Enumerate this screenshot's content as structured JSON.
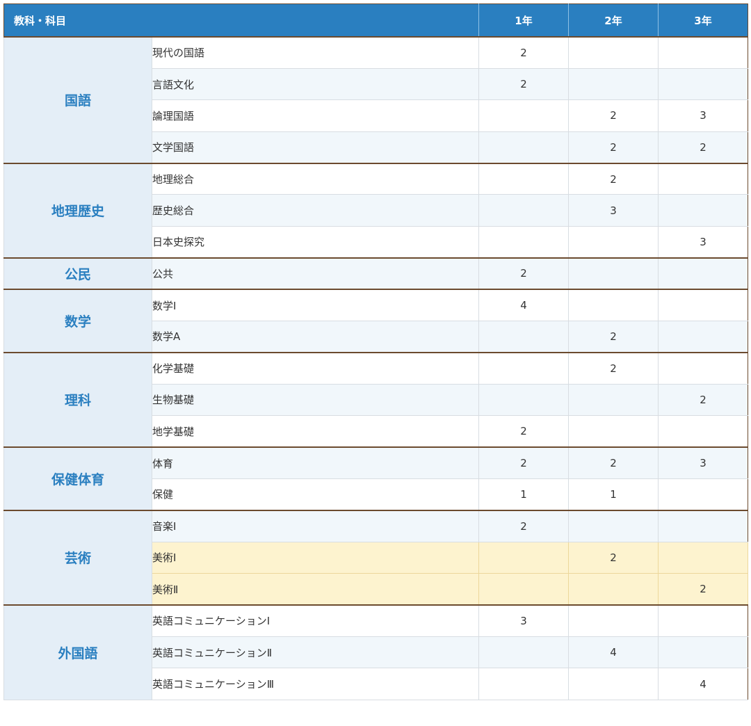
{
  "header": {
    "category_label": "教科・科目",
    "years": [
      "1年",
      "2年",
      "3年"
    ]
  },
  "groups": [
    {
      "category": "国語",
      "subjects": [
        {
          "name": "現代の国語",
          "credits": [
            "2",
            "",
            ""
          ]
        },
        {
          "name": "言語文化",
          "credits": [
            "2",
            "",
            ""
          ]
        },
        {
          "name": "論理国語",
          "credits": [
            "",
            "2",
            "3"
          ]
        },
        {
          "name": "文学国語",
          "credits": [
            "",
            "2",
            "2"
          ]
        }
      ]
    },
    {
      "category": "地理歴史",
      "subjects": [
        {
          "name": "地理総合",
          "credits": [
            "",
            "2",
            ""
          ]
        },
        {
          "name": "歴史総合",
          "credits": [
            "",
            "3",
            ""
          ]
        },
        {
          "name": "日本史探究",
          "credits": [
            "",
            "",
            "3"
          ]
        }
      ]
    },
    {
      "category": "公民",
      "subjects": [
        {
          "name": "公共",
          "credits": [
            "2",
            "",
            ""
          ]
        }
      ]
    },
    {
      "category": "数学",
      "subjects": [
        {
          "name": "数学Ⅰ",
          "credits": [
            "4",
            "",
            ""
          ]
        },
        {
          "name": "数学A",
          "credits": [
            "",
            "2",
            ""
          ]
        }
      ]
    },
    {
      "category": "理科",
      "subjects": [
        {
          "name": "化学基礎",
          "credits": [
            "",
            "2",
            ""
          ]
        },
        {
          "name": "生物基礎",
          "credits": [
            "",
            "",
            "2"
          ]
        },
        {
          "name": "地学基礎",
          "credits": [
            "2",
            "",
            ""
          ]
        }
      ]
    },
    {
      "category": "保健体育",
      "subjects": [
        {
          "name": "体育",
          "credits": [
            "2",
            "2",
            "3"
          ]
        },
        {
          "name": "保健",
          "credits": [
            "1",
            "1",
            ""
          ]
        }
      ]
    },
    {
      "category": "芸術",
      "subjects": [
        {
          "name": "音楽Ⅰ",
          "credits": [
            "2",
            "",
            ""
          ]
        },
        {
          "name": "美術Ⅰ",
          "credits": [
            "",
            "2",
            ""
          ],
          "highlight": true
        },
        {
          "name": "美術Ⅱ",
          "credits": [
            "",
            "",
            "2"
          ],
          "highlight": true
        }
      ]
    },
    {
      "category": "外国語",
      "subjects": [
        {
          "name": "英語コミュニケーションⅠ",
          "credits": [
            "3",
            "",
            ""
          ]
        },
        {
          "name": "英語コミュニケーションⅡ",
          "credits": [
            "",
            "4",
            ""
          ]
        },
        {
          "name": "英語コミュニケーションⅢ",
          "credits": [
            "",
            "",
            "4"
          ]
        }
      ]
    }
  ],
  "colors": {
    "header_bg": "#2a7fc0",
    "category_text": "#2a7fc0",
    "category_bg": "#e4eef7",
    "highlight_bg": "#fdf3cf",
    "group_border": "#6b4a2e"
  }
}
